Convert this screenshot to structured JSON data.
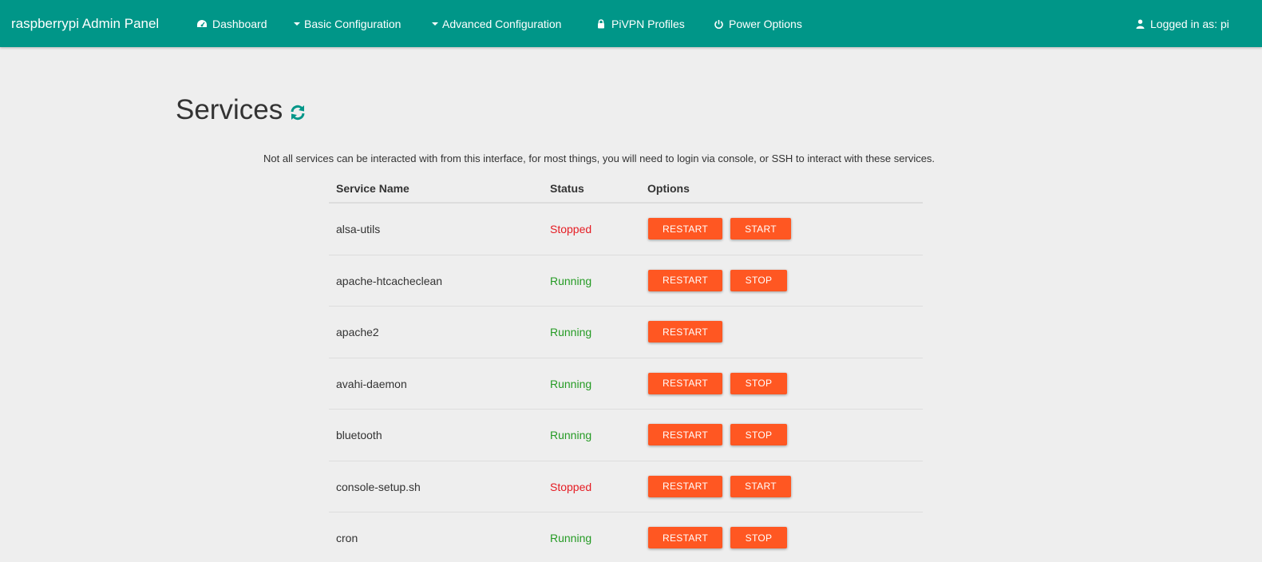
{
  "navbar": {
    "brand": "raspberrypi Admin Panel",
    "items": [
      {
        "label": "Dashboard",
        "icon": "dashboard-icon"
      },
      {
        "label": "Basic Configuration",
        "icon": "caret-down-icon"
      },
      {
        "label": "Advanced Configuration",
        "icon": "caret-down-icon"
      },
      {
        "label": "PiVPN Profiles",
        "icon": "lock-icon"
      },
      {
        "label": "Power Options",
        "icon": "power-icon"
      }
    ],
    "user": {
      "label": "Logged in as: pi",
      "icon": "user-icon"
    }
  },
  "page": {
    "title": "Services",
    "refresh_icon": "refresh-icon",
    "intro": "Not all services can be interacted with from this interface, for most things, you will need to login via console, or SSH to interact with these services."
  },
  "table": {
    "headers": [
      "Service Name",
      "Status",
      "Options"
    ],
    "rows": [
      {
        "name": "alsa-utils",
        "status": "Stopped",
        "restart": "RESTART",
        "action": "START"
      },
      {
        "name": "apache-htcacheclean",
        "status": "Running",
        "restart": "RESTART",
        "action": "STOP"
      },
      {
        "name": "apache2",
        "status": "Running",
        "restart": "RESTART",
        "action": null
      },
      {
        "name": "avahi-daemon",
        "status": "Running",
        "restart": "RESTART",
        "action": "STOP"
      },
      {
        "name": "bluetooth",
        "status": "Running",
        "restart": "RESTART",
        "action": "STOP"
      },
      {
        "name": "console-setup.sh",
        "status": "Stopped",
        "restart": "RESTART",
        "action": "START"
      },
      {
        "name": "cron",
        "status": "Running",
        "restart": "RESTART",
        "action": "STOP"
      }
    ]
  },
  "colors": {
    "navbar": "#009688",
    "button": "#ff5722",
    "running": "#259b24",
    "stopped": "#e51c23",
    "background": "#eeeeee"
  }
}
